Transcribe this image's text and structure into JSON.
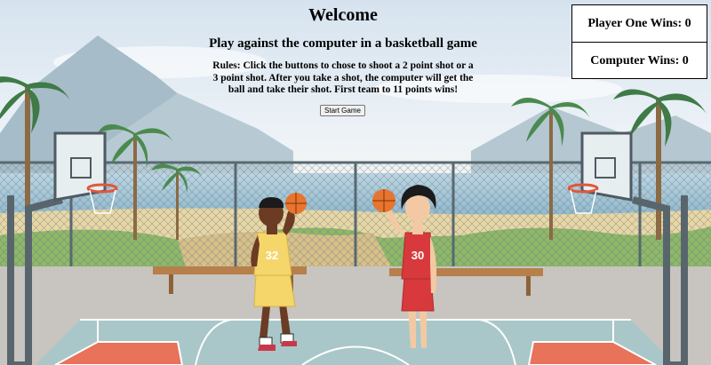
{
  "header": {
    "title": "Welcome",
    "subtitle": "Play against the computer in a basketball game",
    "rules": "Rules: Click the buttons to chose to shoot a 2 point shot or a 3 point shot. After you take a shot, the computer will get the ball and take their shot. First team to 11 points wins!",
    "start_button": "Start Game"
  },
  "scoreboard": {
    "player_one_label": "Player One Wins: 0",
    "computer_label": "Computer Wins: 0"
  },
  "players": {
    "left_jersey": "32",
    "right_jersey": "30"
  },
  "colors": {
    "sky": "#dfe9f3",
    "court": "#a9c7c9",
    "paint": "#e8725a",
    "left_jersey": "#f5d66b",
    "right_jersey": "#d7393c",
    "ball": "#e8742d"
  }
}
